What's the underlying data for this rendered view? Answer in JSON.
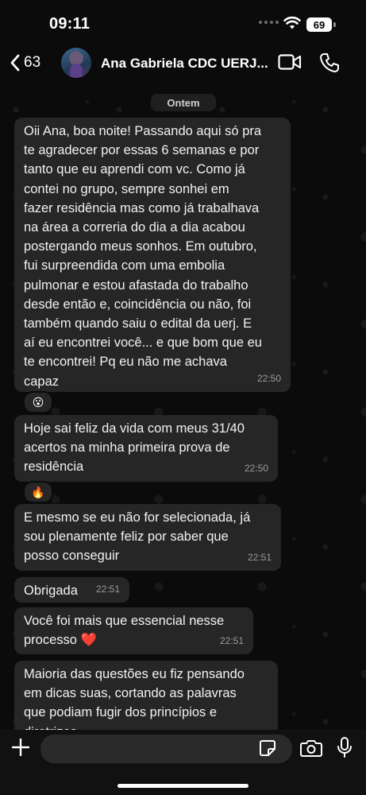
{
  "status_bar": {
    "time": "09:11",
    "battery": "69"
  },
  "header": {
    "back_count": "63",
    "contact_name": "Ana Gabriela CDC UERJ..."
  },
  "chat": {
    "date_label": "Ontem",
    "messages": [
      {
        "text": "Oii Ana, boa noite! Passando aqui só pra\nte agradecer por essas 6 semanas e por\ntanto que eu aprendi com vc. Como já\ncontei no grupo, sempre sonhei em\nfazer residência mas como já trabalhava\nna área a correria do dia a dia acabou\npostergando meus sonhos. Em outubro,\nfui surpreendida com uma embolia\npulmonar e estou afastada do trabalho\ndesde então e, coincidência ou não, foi\ntambém quando saiu o edital da uerj. E\naí eu encontrei você... e que bom que eu\nte encontrei! Pq eu não me achava\ncapaz",
        "time": "22:50",
        "reaction": "😮"
      },
      {
        "text": "Hoje sai feliz da vida com meus 31/40\nacertos na minha primeira prova de\nresidência",
        "time": "22:50",
        "reaction": "🔥"
      },
      {
        "text": "E mesmo se eu não for selecionada, já\nsou plenamente feliz por saber que\nposso conseguir",
        "time": "22:51"
      },
      {
        "text": "Obrigada",
        "time": "22:51"
      },
      {
        "text": "Você foi mais que essencial nesse\nprocesso ❤️",
        "time": "22:51"
      },
      {
        "text": "Maioria das questões eu fiz pensando\nem dicas suas, cortando as palavras\nque podiam fugir dos princípios e\ndiretrizes"
      }
    ]
  },
  "icons": {
    "back": "chevron-left-icon",
    "video": "video-icon",
    "call": "phone-icon",
    "plus": "plus-icon",
    "sticker": "sticker-icon",
    "camera": "camera-icon",
    "mic": "mic-icon"
  },
  "colors": {
    "background": "#0b0b0b",
    "bubble": "#262626",
    "heart": "#e0202e"
  }
}
